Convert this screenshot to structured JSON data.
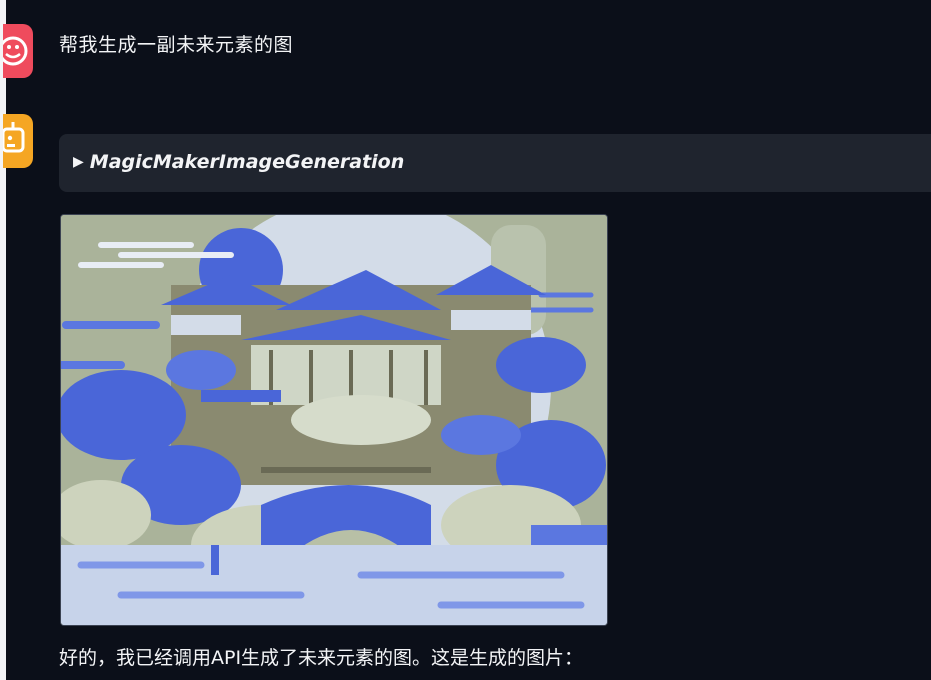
{
  "conversation": {
    "user_message": "帮我生成一副未来元素的图",
    "tool_call": {
      "arrow": "▶",
      "name": "MagicMakerImageGeneration"
    },
    "bot_message": "好的，我已经调用API生成了未来元素的图。这是生成的图片："
  },
  "avatars": {
    "user_icon": "user-avatar-icon",
    "bot_icon": "robot-avatar-icon",
    "user_color": "#ef4b5d",
    "bot_color": "#f5a623"
  },
  "image": {
    "subject": "blue and beige illustrated Chinese palace with trees and bridge"
  },
  "colors": {
    "background": "#0b0f19",
    "tool_box": "#1f242e",
    "text": "#f3f4f6"
  }
}
